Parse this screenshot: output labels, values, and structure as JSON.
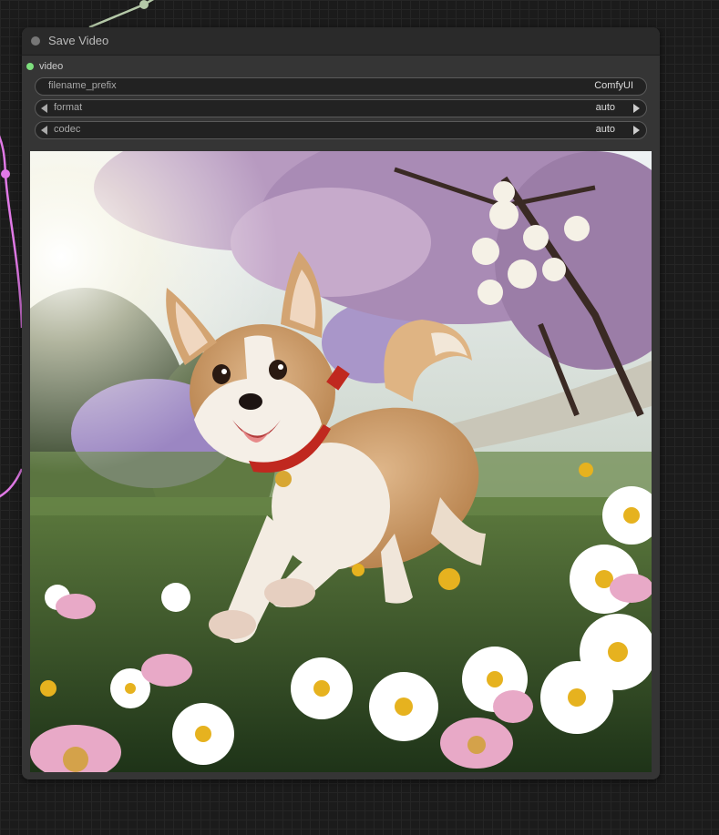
{
  "node": {
    "title": "Save Video",
    "input": {
      "label": "video",
      "color": "#7ee07e"
    },
    "widgets": {
      "filename_prefix": {
        "label": "filename_prefix",
        "value": "ComfyUI"
      },
      "format": {
        "label": "format",
        "value": "auto"
      },
      "codec": {
        "label": "codec",
        "value": "auto"
      }
    }
  },
  "preview": {
    "description_icon": "video-preview-image"
  },
  "colors": {
    "canvas_bg": "#1b1b1b",
    "node_bg": "#353535",
    "link_pink": "#e079e6",
    "link_green": "#b5c9a8"
  }
}
